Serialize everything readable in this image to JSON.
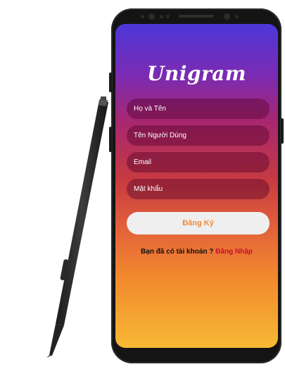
{
  "app": {
    "logo": "Unigram"
  },
  "form": {
    "fields": [
      {
        "placeholder": "Họ và Tên"
      },
      {
        "placeholder": "Tên Người Dùng"
      },
      {
        "placeholder": "Email"
      },
      {
        "placeholder": "Mật khẩu"
      }
    ],
    "register_label": "Đăng Ký",
    "account_prompt": "Bạn đã có tài khoản ?",
    "login_link": "Đăng Nhập"
  },
  "colors": {
    "gradient_top": "#4d36d8",
    "gradient_bottom": "#f7b834",
    "button_text": "#ee8a3a",
    "link": "#c8102e"
  }
}
